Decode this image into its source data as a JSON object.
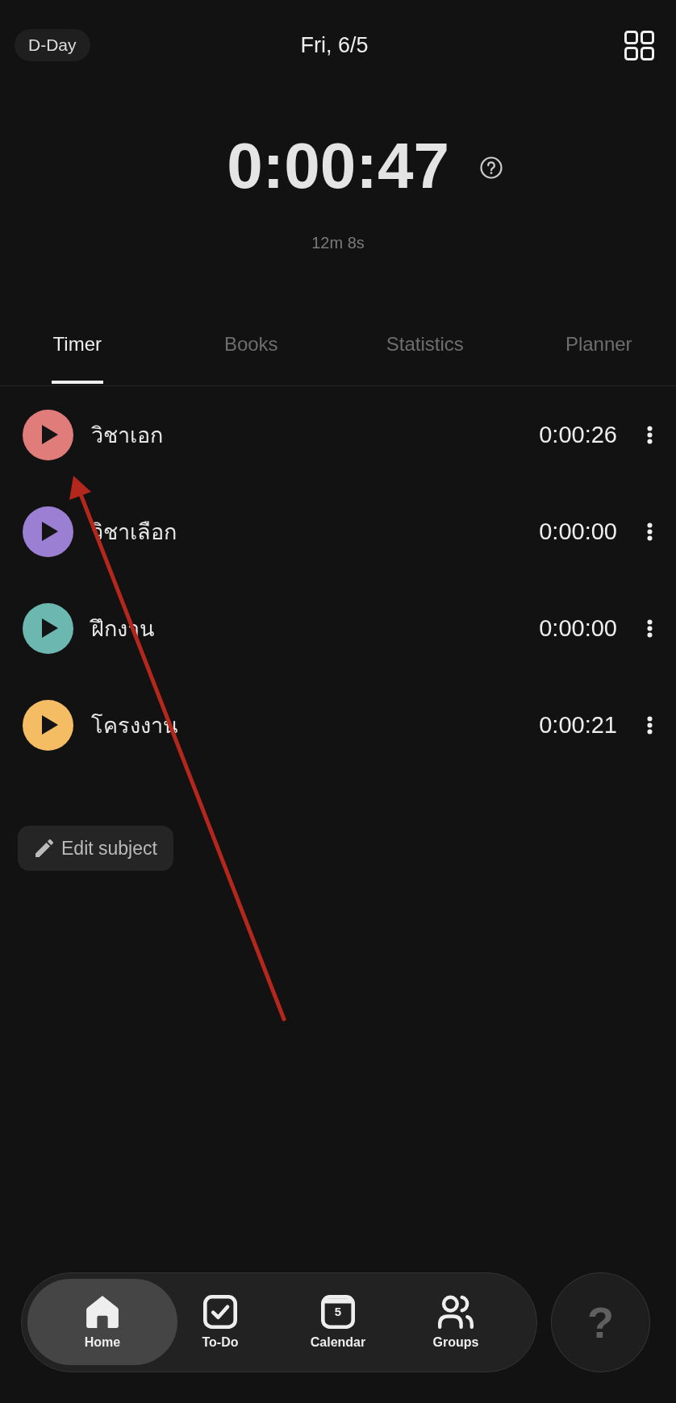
{
  "header": {
    "d_day": "D-Day",
    "date": "Fri, 6/5"
  },
  "timer": {
    "elapsed": "0:00:47",
    "session": "12m 8s"
  },
  "tabs": [
    {
      "label": "Timer",
      "selected": true
    },
    {
      "label": "Books",
      "selected": false
    },
    {
      "label": "Statistics",
      "selected": false
    },
    {
      "label": "Planner",
      "selected": false
    }
  ],
  "subjects": [
    {
      "name": "วิชาเอก",
      "time": "0:00:26",
      "color": "#e07c79"
    },
    {
      "name": "วิชาเลือก",
      "time": "0:00:00",
      "color": "#9a7fd2"
    },
    {
      "name": "ฝึกงาน",
      "time": "0:00:00",
      "color": "#6cb8b0"
    },
    {
      "name": "โครงงาน",
      "time": "0:00:21",
      "color": "#f5bd63"
    }
  ],
  "edit_button": {
    "label": "Edit subject"
  },
  "bottom_nav": {
    "items": [
      {
        "kind": "home",
        "label": "Home",
        "selected": true
      },
      {
        "kind": "todo",
        "label": "To-Do",
        "selected": false
      },
      {
        "kind": "calendar",
        "label": "Calendar",
        "day": "5",
        "selected": false
      },
      {
        "kind": "groups",
        "label": "Groups",
        "selected": false
      }
    ]
  },
  "help_button": {
    "label": "?"
  },
  "annotations": [
    {
      "kind": "arrow"
    }
  ]
}
